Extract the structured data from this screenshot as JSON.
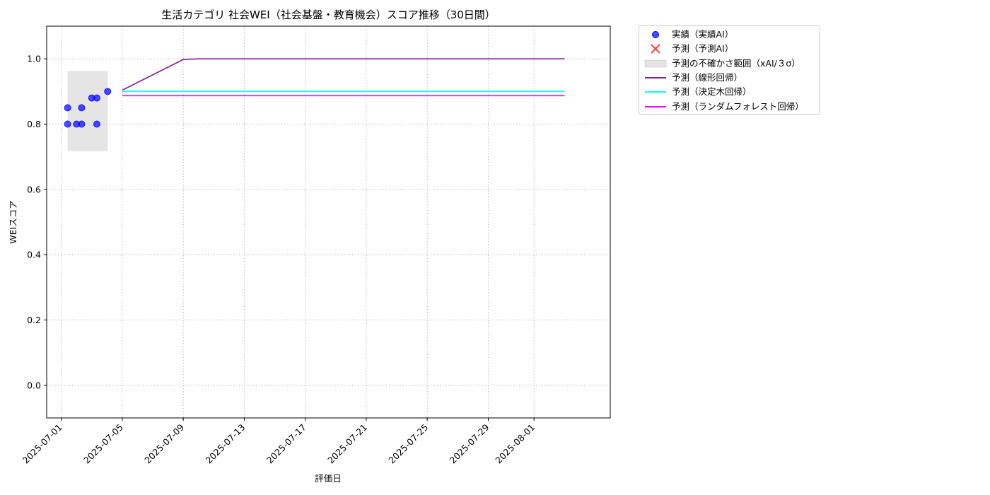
{
  "chart_data": {
    "type": "line",
    "title": "生活カテゴリ 社会WEI（社会基盤・教育機会）スコア推移（30日間）",
    "xlabel": "評価日",
    "ylabel": "WEIスコア",
    "xlim": [
      "2025-06-30T01:00",
      "2025-08-06T00:00"
    ],
    "ylim": [
      -0.1,
      1.1
    ],
    "x_ticks": [
      "2025-07-01",
      "2025-07-05",
      "2025-07-09",
      "2025-07-13",
      "2025-07-17",
      "2025-07-21",
      "2025-07-25",
      "2025-07-29",
      "2025-08-01"
    ],
    "y_ticks": [
      "0.0",
      "0.2",
      "0.4",
      "0.6",
      "0.8",
      "1.0"
    ],
    "grid": true,
    "legend_position": "outside-upper-right",
    "actual": {
      "name": "実績（実績AI）",
      "color": "#0000ff",
      "points": [
        {
          "x": "2025-07-01T10:00",
          "y": 0.85
        },
        {
          "x": "2025-07-01T10:00",
          "y": 0.8
        },
        {
          "x": "2025-07-02T00:00",
          "y": 0.8
        },
        {
          "x": "2025-07-02T08:00",
          "y": 0.85
        },
        {
          "x": "2025-07-02T08:00",
          "y": 0.8
        },
        {
          "x": "2025-07-03T00:00",
          "y": 0.88
        },
        {
          "x": "2025-07-03T08:00",
          "y": 0.88
        },
        {
          "x": "2025-07-03T08:00",
          "y": 0.8
        },
        {
          "x": "2025-07-04T01:00",
          "y": 0.9
        }
      ]
    },
    "predicted_ai": {
      "name": "予測（予測AI）",
      "color": "#ff0000",
      "points": []
    },
    "uncertainty": {
      "name": "予測の不確かさ範囲（xAI/３σ）",
      "color": "#d3d3d3",
      "x_start": "2025-07-01T10:00",
      "x_end": "2025-07-04T01:00",
      "y_low": 0.717,
      "y_high": 0.963
    },
    "series": [
      {
        "name": "予測（線形回帰）",
        "color": "#8b1a9e",
        "points": [
          {
            "x": "2025-07-05T00:00",
            "y": 0.904
          },
          {
            "x": "2025-07-09T00:00",
            "y": 0.998
          },
          {
            "x": "2025-07-10T00:00",
            "y": 1.0
          },
          {
            "x": "2025-08-03T00:00",
            "y": 1.0
          }
        ]
      },
      {
        "name": "予測（決定木回帰）",
        "color": "#00ffff",
        "points": [
          {
            "x": "2025-07-05T00:00",
            "y": 0.9
          },
          {
            "x": "2025-08-03T00:00",
            "y": 0.9
          }
        ]
      },
      {
        "name": "予測（ランダムフォレスト回帰）",
        "color": "#ff00ff",
        "points": [
          {
            "x": "2025-07-05T00:00",
            "y": 0.887
          },
          {
            "x": "2025-08-03T00:00",
            "y": 0.887
          }
        ]
      }
    ]
  }
}
